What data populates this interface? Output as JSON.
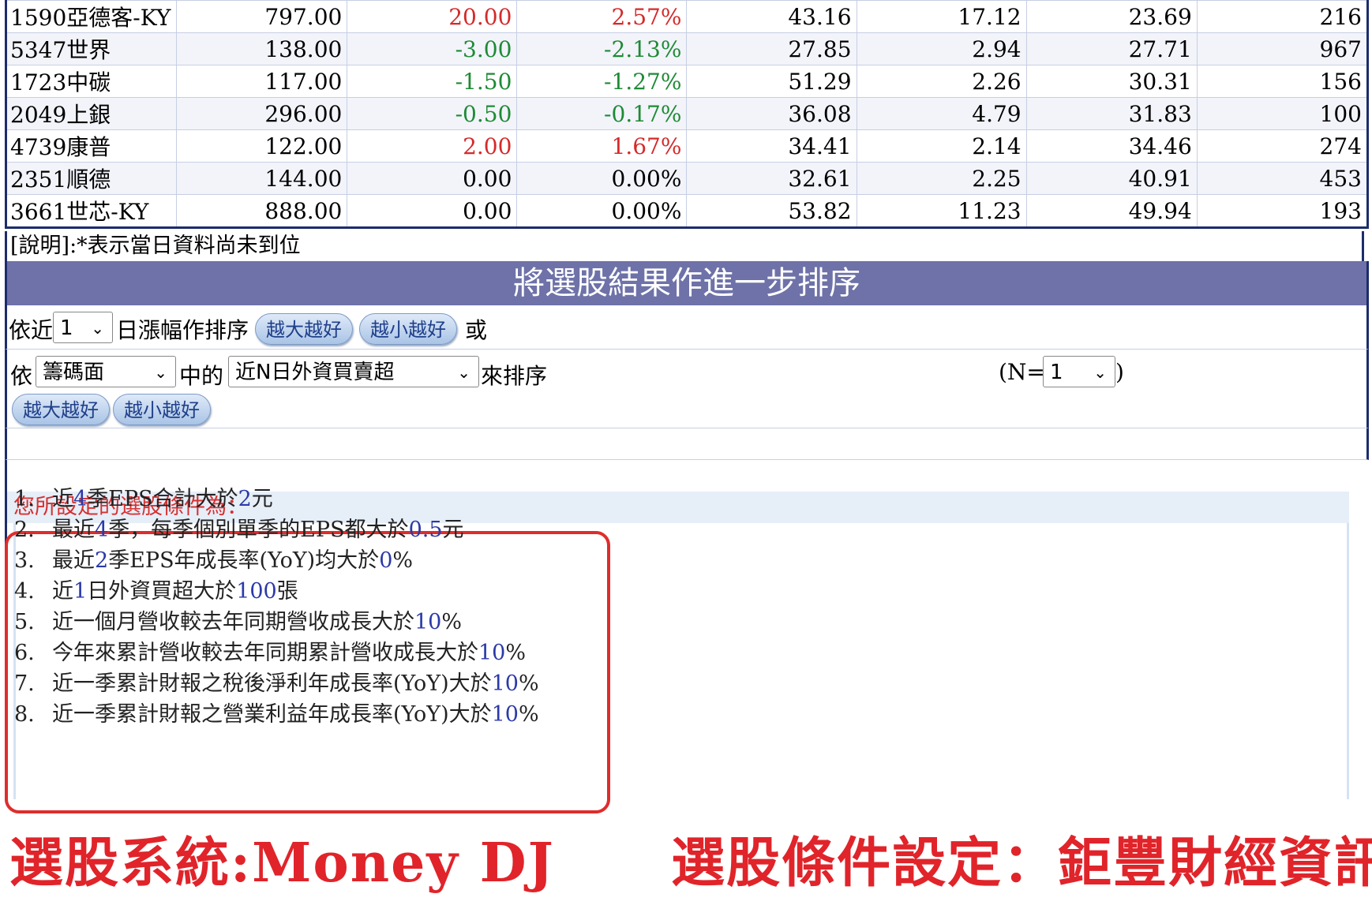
{
  "stock_table": {
    "rows": [
      {
        "name": "1590亞德客-KY",
        "price": "797.00",
        "change": "20.00",
        "pct": "2.57%",
        "c5": "43.16",
        "c6": "17.12",
        "c7": "23.69",
        "c8": "216",
        "dir": "up"
      },
      {
        "name": "5347世界",
        "price": "138.00",
        "change": "-3.00",
        "pct": "-2.13%",
        "c5": "27.85",
        "c6": "2.94",
        "c7": "27.71",
        "c8": "967",
        "dir": "down"
      },
      {
        "name": "1723中碳",
        "price": "117.00",
        "change": "-1.50",
        "pct": "-1.27%",
        "c5": "51.29",
        "c6": "2.26",
        "c7": "30.31",
        "c8": "156",
        "dir": "down"
      },
      {
        "name": "2049上銀",
        "price": "296.00",
        "change": "-0.50",
        "pct": "-0.17%",
        "c5": "36.08",
        "c6": "4.79",
        "c7": "31.83",
        "c8": "100",
        "dir": "down"
      },
      {
        "name": "4739康普",
        "price": "122.00",
        "change": "2.00",
        "pct": "1.67%",
        "c5": "34.41",
        "c6": "2.14",
        "c7": "34.46",
        "c8": "274",
        "dir": "up"
      },
      {
        "name": "2351順德",
        "price": "144.00",
        "change": "0.00",
        "pct": "0.00%",
        "c5": "32.61",
        "c6": "2.25",
        "c7": "40.91",
        "c8": "453",
        "dir": "flat"
      },
      {
        "name": "3661世芯-KY",
        "price": "888.00",
        "change": "0.00",
        "pct": "0.00%",
        "c5": "53.82",
        "c6": "11.23",
        "c7": "49.94",
        "c8": "193",
        "dir": "flat"
      }
    ],
    "colors": {
      "up": "#d52a2a",
      "down": "#1f8a35",
      "flat": "#000000"
    }
  },
  "note": "[說明]:*表示當日資料尚未到位",
  "sort_section": {
    "title": "將選股結果作進一步排序",
    "row1": {
      "prefix": "依近",
      "days_value": "1",
      "suffix": "日漲幅作排序",
      "btn_desc": "越大越好",
      "btn_asc": "越小越好",
      "or": "或"
    },
    "row2": {
      "prefix": "依",
      "category_value": "籌碼面",
      "middle": "中的",
      "metric_value": "近N日外資買賣超",
      "suffix": "來排序",
      "n_label": "(N=",
      "n_value": "1",
      "n_close": ")",
      "btn_desc": "越大越好",
      "btn_asc": "越小越好"
    }
  },
  "conditions": {
    "title": "您所設定的選股條件為：",
    "items": [
      {
        "num": "1.",
        "parts": [
          [
            "近",
            0
          ],
          [
            "4",
            1
          ],
          [
            "季EPS合計大於",
            0
          ],
          [
            "2",
            1
          ],
          [
            "元",
            0
          ]
        ]
      },
      {
        "num": "2.",
        "parts": [
          [
            "最近",
            0
          ],
          [
            "4",
            1
          ],
          [
            "季，每季個別單季的EPS都大於",
            0
          ],
          [
            "0.5",
            1
          ],
          [
            "元",
            0
          ]
        ]
      },
      {
        "num": "3.",
        "parts": [
          [
            "最近",
            0
          ],
          [
            "2",
            1
          ],
          [
            "季EPS年成長率(YoY)均大於",
            0
          ],
          [
            "0",
            1
          ],
          [
            "%",
            0
          ]
        ]
      },
      {
        "num": "4.",
        "parts": [
          [
            "近",
            0
          ],
          [
            "1",
            1
          ],
          [
            "日外資買超大於",
            0
          ],
          [
            "100",
            1
          ],
          [
            "張",
            0
          ]
        ]
      },
      {
        "num": "5.",
        "parts": [
          [
            "近一個月營收較去年同期營收成長大於",
            0
          ],
          [
            "10",
            1
          ],
          [
            "%",
            0
          ]
        ]
      },
      {
        "num": "6.",
        "parts": [
          [
            "今年來累計營收較去年同期累計營收成長大於",
            0
          ],
          [
            "10",
            1
          ],
          [
            "%",
            0
          ]
        ]
      },
      {
        "num": "7.",
        "parts": [
          [
            "近一季累計財報之稅後淨利年成長率(YoY)大於",
            0
          ],
          [
            "10",
            1
          ],
          [
            "%",
            0
          ]
        ]
      },
      {
        "num": "8.",
        "parts": [
          [
            "近一季累計財報之營業利益年成長率(YoY)大於",
            0
          ],
          [
            "10",
            1
          ],
          [
            "%",
            0
          ]
        ]
      }
    ]
  },
  "footer": {
    "left": "選股系統:Money DJ",
    "right": "選股條件設定：鉅豐財經資訊"
  }
}
